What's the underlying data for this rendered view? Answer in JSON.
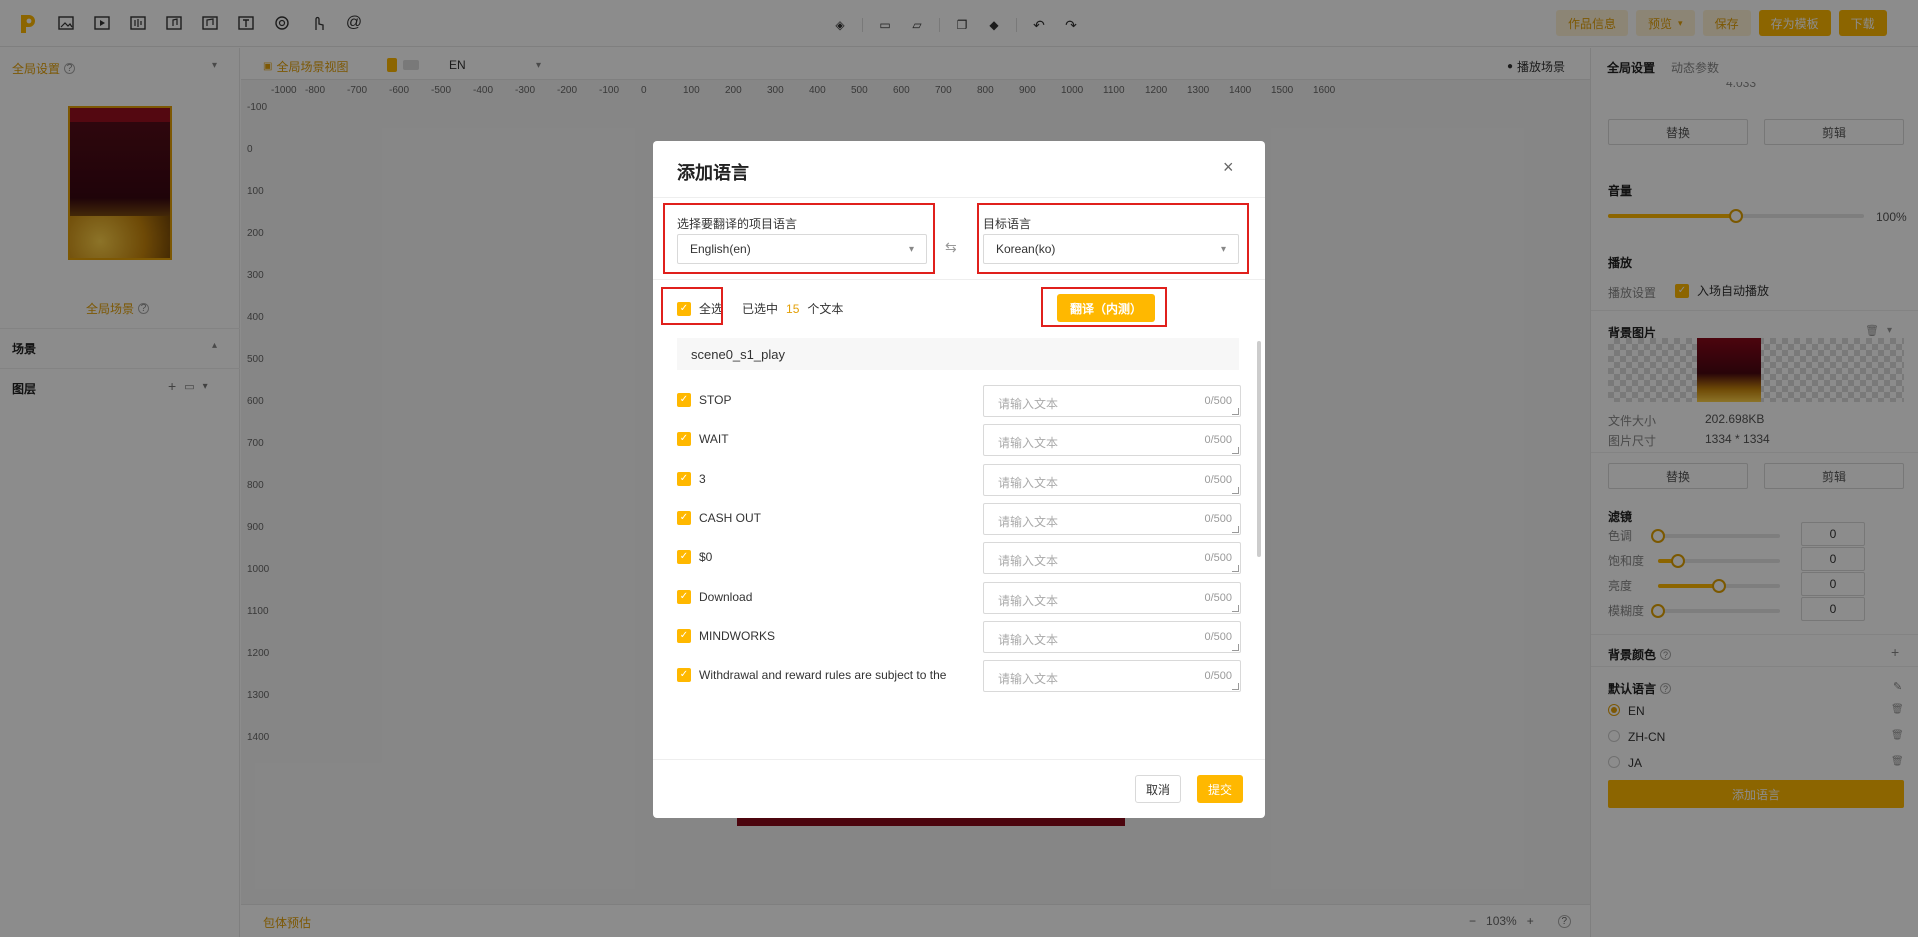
{
  "topbar": {
    "right_buttons": {
      "info": "作品信息",
      "preview": "预览",
      "save": "保存",
      "save_template": "存为模板",
      "download": "下载"
    }
  },
  "left_panel": {
    "global_settings": "全局设置",
    "global_scene": "全局场景",
    "scene": "场景",
    "layers": "图层"
  },
  "center": {
    "global_view": "全局场景视图",
    "lang": "EN",
    "play_scene": "播放场景",
    "ruler_x": [
      "-1000",
      "-800",
      "-700",
      "-600",
      "-500",
      "-400",
      "-300",
      "-200",
      "-100",
      "0",
      "100",
      "200",
      "300",
      "400",
      "500",
      "600",
      "700",
      "800",
      "900",
      "1000",
      "1100",
      "1200",
      "1300",
      "1400",
      "1500",
      "1600"
    ],
    "ruler_y": [
      "-100",
      "0",
      "100",
      "200",
      "300",
      "400",
      "500",
      "600",
      "700",
      "800",
      "900",
      "1000",
      "1100",
      "1200",
      "1300",
      "1400"
    ],
    "bottom_left": "包体预估",
    "zoom": "103%"
  },
  "right_panel": {
    "tabs": [
      "全局设置",
      "动态参数"
    ],
    "partial_value": "4.033",
    "replace": "替换",
    "crop": "剪辑",
    "volume_title": "音量",
    "volume_value": "100%",
    "volume_level": 0.5,
    "play_title": "播放",
    "play_setting": "播放设置",
    "autoplay": "入场自动播放",
    "bg_image_title": "背景图片",
    "file_size_label": "文件大小",
    "file_size": "202.698KB",
    "img_size_label": "图片尺寸",
    "img_size": "1334 * 1334",
    "filter_title": "滤镜",
    "filters": [
      {
        "label": "色调",
        "value": "0",
        "level": 0
      },
      {
        "label": "饱和度",
        "value": "0",
        "level": 0.16
      },
      {
        "label": "亮度",
        "value": "0",
        "level": 0.5
      },
      {
        "label": "模糊度",
        "value": "0",
        "level": 0
      }
    ],
    "bg_color_title": "背景颜色",
    "default_lang_title": "默认语言",
    "languages": [
      "EN",
      "ZH-CN",
      "JA"
    ],
    "add_lang": "添加语言"
  },
  "dialog": {
    "title": "添加语言",
    "source_label": "选择要翻译的项目语言",
    "source_value": "English(en)",
    "target_label": "目标语言",
    "target_value": "Korean(ko)",
    "select_all": "全选",
    "selected_prefix": "已选中",
    "selected_count": "15",
    "selected_suffix": "个文本",
    "translate_btn": "翻译（内测）",
    "group_name": "scene0_s1_play",
    "placeholder": "请输入文本",
    "counter": "0/500",
    "items": [
      "STOP",
      "WAIT",
      "3",
      "CASH OUT",
      "$0",
      "Download",
      "MINDWORKS",
      "Withdrawal and reward rules are subject to the"
    ],
    "cancel": "取消",
    "submit": "提交"
  }
}
